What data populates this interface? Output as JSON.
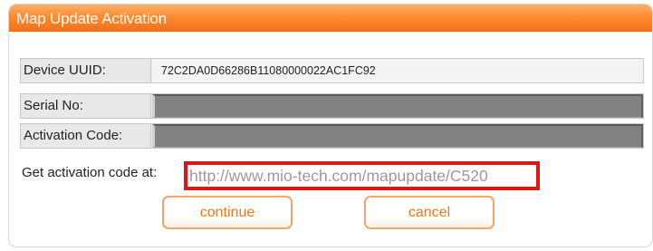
{
  "dialog": {
    "title": "Map Update Activation"
  },
  "fields": {
    "device_uuid_label": "Device UUID:",
    "device_uuid_value": "72C2DA0D66286B11080000022AC1FC92",
    "serial_label": "Serial No:",
    "activation_label": "Activation Code:"
  },
  "info": {
    "prefix": "Get activation code at:",
    "url": "http://www.mio-tech.com/mapupdate/C520"
  },
  "buttons": {
    "continue_label": "continue",
    "cancel_label": "cancel"
  },
  "colors": {
    "title_orange": "#f37116",
    "button_text": "#f07820",
    "highlight_red": "#e01515"
  }
}
